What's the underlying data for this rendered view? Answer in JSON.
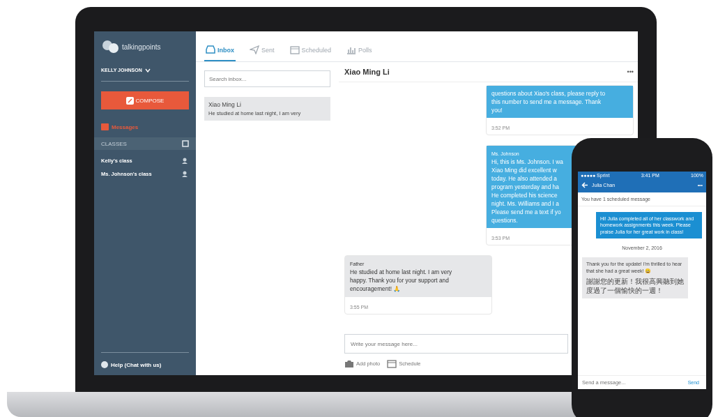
{
  "sidebar": {
    "brand": "talkingpoints",
    "user": "KELLY JOHNSON",
    "compose": "COMPOSE",
    "nav": [
      {
        "label": "Messages",
        "selected": true
      }
    ],
    "section": "CLASSES",
    "classes": [
      {
        "label": "Kelly's class",
        "selected": false
      },
      {
        "label": "Ms. Johnson's class",
        "selected": false
      }
    ],
    "help": "Help (Chat with us)"
  },
  "tabs": [
    {
      "label": "Inbox",
      "selected": true
    },
    {
      "label": "Sent",
      "selected": false
    },
    {
      "label": "Scheduled",
      "selected": false
    },
    {
      "label": "Polls",
      "selected": false
    }
  ],
  "search": {
    "placeholder": "Search inbox..."
  },
  "conversations": [
    {
      "name": "Xiao Ming Li",
      "preview": "He studied at home last night, I am very",
      "selected": true
    }
  ],
  "chat": {
    "title": "Xiao Ming Li",
    "menu": "•••",
    "messages": [
      {
        "kind": "outgoing",
        "lines": [
          "questions about Xiao's class, please reply to",
          "this number to send me a message. Thank",
          "you!"
        ],
        "time": "3:52 PM"
      },
      {
        "kind": "outgoing",
        "sender": "Ms. Johnson",
        "lines": [
          "Hi, this is Ms. Johnson. I wa",
          "Xiao Ming did excellent w",
          "today. He also attended a",
          "program yesterday and ha",
          "He completed his science",
          "night. Ms. Williams and I a",
          "Please send me a text if yo",
          "questions."
        ],
        "time": "3:53 PM"
      },
      {
        "kind": "incoming",
        "sender": "Father",
        "lines": [
          "He studied at home last night. I am very",
          "happy. Thank you for your support and",
          "encouragement! 🙏"
        ],
        "time": "3:55 PM"
      }
    ],
    "composer": {
      "placeholder": "Write your message here..."
    },
    "actions": [
      {
        "label": "Add photo"
      },
      {
        "label": "Schedule"
      }
    ]
  },
  "phone": {
    "carrier": "●●●●● Sprint",
    "clock": "3:41 PM",
    "battery": "100%",
    "title": "Julia Chan",
    "menu": "•••",
    "notice": "You have 1 scheduled message",
    "messages": [
      {
        "kind": "outgoing",
        "text": "Hi! Julia completed all of her classwork and homework assignments this week. Please praise Julia for her great work in class!"
      },
      {
        "kind": "date",
        "text": "November 2, 2016"
      },
      {
        "kind": "incoming",
        "text": "Thank you for the update! I'm thrilled to hear that she had a great week! 😀",
        "extra": "謝謝您的更新！我很高興聽到她度過了一個愉快的一週！"
      }
    ],
    "composer": {
      "placeholder": "Send a message..."
    },
    "send": "Send"
  }
}
